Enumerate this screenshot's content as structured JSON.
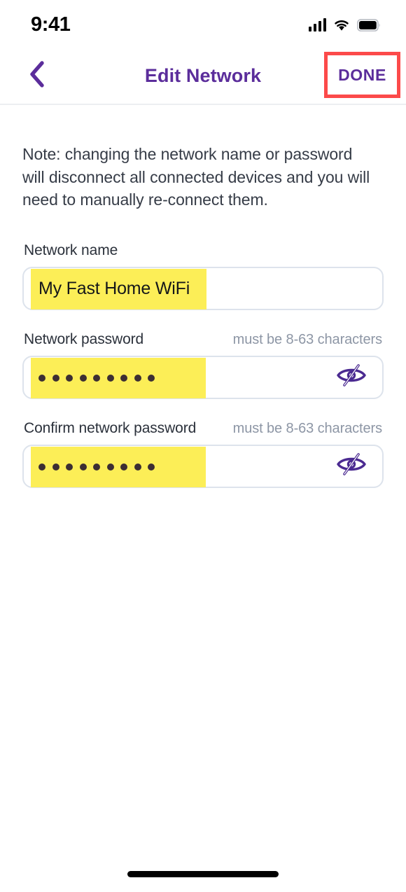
{
  "status_bar": {
    "time": "9:41",
    "signal_icon": "cellular-signal-icon",
    "wifi_icon": "wifi-icon",
    "battery_icon": "battery-full-icon"
  },
  "nav": {
    "back_icon": "chevron-left-icon",
    "title": "Edit Network",
    "done_label": "DONE",
    "annotation_color": "#FC4A4A"
  },
  "main": {
    "note": "Note: changing the network name or password will disconnect all connected devices and you will need to manually re-connect them.",
    "fields": [
      {
        "label": "Network name",
        "hint": "",
        "value": "My Fast Home WiFi",
        "masked": false,
        "highlight_color": "#FCEE57",
        "has_toggle": false
      },
      {
        "label": "Network password",
        "hint": "must be 8-63 characters",
        "value": "•••••••••",
        "masked": true,
        "dot_count": 9,
        "highlight_color": "#FCEE57",
        "has_toggle": true,
        "toggle_icon": "eye-off-icon"
      },
      {
        "label": "Confirm network password",
        "hint": "must be 8-63 characters",
        "value": "•••••••••",
        "masked": true,
        "dot_count": 9,
        "highlight_color": "#FCEE57",
        "has_toggle": true,
        "toggle_icon": "eye-off-icon"
      }
    ]
  },
  "theme": {
    "accent_purple": "#5B2D9B",
    "highlight_yellow": "#FCEE57",
    "annotation_red": "#FC4A4A",
    "hint_gray": "#8D96A5",
    "border_gray": "#DDE3EC"
  },
  "home_indicator": "home-indicator"
}
